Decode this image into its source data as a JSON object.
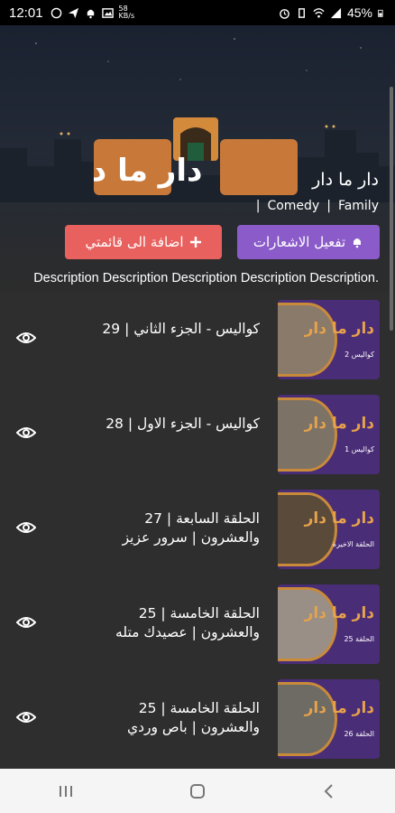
{
  "status": {
    "time": "12:01",
    "net_speed": "58",
    "net_unit": "KB/s",
    "battery": "45%"
  },
  "show": {
    "logo_text": "دار ما دار",
    "title": "دار ما دار",
    "genres": [
      "|",
      "Comedy",
      "|",
      "Family"
    ],
    "notify_label": "تفعيل الاشعارات",
    "add_label": "اضافة الى قائمتي",
    "description": "Description Description Description Description Description."
  },
  "episodes": [
    {
      "number": "29",
      "title": "كواليس - الجزء الثاني",
      "thumb_brand": "دار ما دار",
      "thumb_sub": "كواليس 2"
    },
    {
      "number": "28",
      "title": "كواليس - الجزء الاول",
      "thumb_brand": "دار ما دار",
      "thumb_sub": "كواليس 1"
    },
    {
      "number": "27",
      "title": "الحلقة السابعة والعشرون | سرور عزيز",
      "thumb_brand": "دار ما دار",
      "thumb_sub": "الحلقة الاخيرة"
    },
    {
      "number": "25",
      "title": "الحلقة الخامسة والعشرون | عصيدك متله",
      "thumb_brand": "دار ما دار",
      "thumb_sub": "الحلقة 25"
    },
    {
      "number": "25",
      "title": "الحلقة الخامسة والعشرون | باص وردي",
      "thumb_brand": "دار ما دار",
      "thumb_sub": "الحلقة 26"
    }
  ],
  "colors": {
    "notify_button": "#8b5cc9",
    "add_button": "#e8615e",
    "logo_orange": "#e08a34",
    "thumb_purple": "#4a2d77"
  }
}
